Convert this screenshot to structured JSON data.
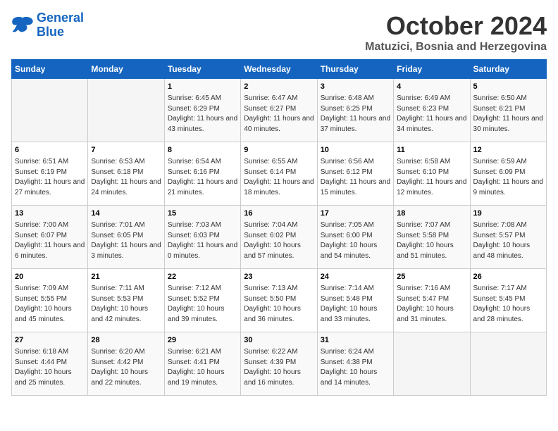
{
  "header": {
    "logo_line1": "General",
    "logo_line2": "Blue",
    "month": "October 2024",
    "location": "Matuzici, Bosnia and Herzegovina"
  },
  "weekdays": [
    "Sunday",
    "Monday",
    "Tuesday",
    "Wednesday",
    "Thursday",
    "Friday",
    "Saturday"
  ],
  "weeks": [
    [
      {
        "day": "",
        "sunrise": "",
        "sunset": "",
        "daylight": ""
      },
      {
        "day": "",
        "sunrise": "",
        "sunset": "",
        "daylight": ""
      },
      {
        "day": "1",
        "sunrise": "Sunrise: 6:45 AM",
        "sunset": "Sunset: 6:29 PM",
        "daylight": "Daylight: 11 hours and 43 minutes."
      },
      {
        "day": "2",
        "sunrise": "Sunrise: 6:47 AM",
        "sunset": "Sunset: 6:27 PM",
        "daylight": "Daylight: 11 hours and 40 minutes."
      },
      {
        "day": "3",
        "sunrise": "Sunrise: 6:48 AM",
        "sunset": "Sunset: 6:25 PM",
        "daylight": "Daylight: 11 hours and 37 minutes."
      },
      {
        "day": "4",
        "sunrise": "Sunrise: 6:49 AM",
        "sunset": "Sunset: 6:23 PM",
        "daylight": "Daylight: 11 hours and 34 minutes."
      },
      {
        "day": "5",
        "sunrise": "Sunrise: 6:50 AM",
        "sunset": "Sunset: 6:21 PM",
        "daylight": "Daylight: 11 hours and 30 minutes."
      }
    ],
    [
      {
        "day": "6",
        "sunrise": "Sunrise: 6:51 AM",
        "sunset": "Sunset: 6:19 PM",
        "daylight": "Daylight: 11 hours and 27 minutes."
      },
      {
        "day": "7",
        "sunrise": "Sunrise: 6:53 AM",
        "sunset": "Sunset: 6:18 PM",
        "daylight": "Daylight: 11 hours and 24 minutes."
      },
      {
        "day": "8",
        "sunrise": "Sunrise: 6:54 AM",
        "sunset": "Sunset: 6:16 PM",
        "daylight": "Daylight: 11 hours and 21 minutes."
      },
      {
        "day": "9",
        "sunrise": "Sunrise: 6:55 AM",
        "sunset": "Sunset: 6:14 PM",
        "daylight": "Daylight: 11 hours and 18 minutes."
      },
      {
        "day": "10",
        "sunrise": "Sunrise: 6:56 AM",
        "sunset": "Sunset: 6:12 PM",
        "daylight": "Daylight: 11 hours and 15 minutes."
      },
      {
        "day": "11",
        "sunrise": "Sunrise: 6:58 AM",
        "sunset": "Sunset: 6:10 PM",
        "daylight": "Daylight: 11 hours and 12 minutes."
      },
      {
        "day": "12",
        "sunrise": "Sunrise: 6:59 AM",
        "sunset": "Sunset: 6:09 PM",
        "daylight": "Daylight: 11 hours and 9 minutes."
      }
    ],
    [
      {
        "day": "13",
        "sunrise": "Sunrise: 7:00 AM",
        "sunset": "Sunset: 6:07 PM",
        "daylight": "Daylight: 11 hours and 6 minutes."
      },
      {
        "day": "14",
        "sunrise": "Sunrise: 7:01 AM",
        "sunset": "Sunset: 6:05 PM",
        "daylight": "Daylight: 11 hours and 3 minutes."
      },
      {
        "day": "15",
        "sunrise": "Sunrise: 7:03 AM",
        "sunset": "Sunset: 6:03 PM",
        "daylight": "Daylight: 11 hours and 0 minutes."
      },
      {
        "day": "16",
        "sunrise": "Sunrise: 7:04 AM",
        "sunset": "Sunset: 6:02 PM",
        "daylight": "Daylight: 10 hours and 57 minutes."
      },
      {
        "day": "17",
        "sunrise": "Sunrise: 7:05 AM",
        "sunset": "Sunset: 6:00 PM",
        "daylight": "Daylight: 10 hours and 54 minutes."
      },
      {
        "day": "18",
        "sunrise": "Sunrise: 7:07 AM",
        "sunset": "Sunset: 5:58 PM",
        "daylight": "Daylight: 10 hours and 51 minutes."
      },
      {
        "day": "19",
        "sunrise": "Sunrise: 7:08 AM",
        "sunset": "Sunset: 5:57 PM",
        "daylight": "Daylight: 10 hours and 48 minutes."
      }
    ],
    [
      {
        "day": "20",
        "sunrise": "Sunrise: 7:09 AM",
        "sunset": "Sunset: 5:55 PM",
        "daylight": "Daylight: 10 hours and 45 minutes."
      },
      {
        "day": "21",
        "sunrise": "Sunrise: 7:11 AM",
        "sunset": "Sunset: 5:53 PM",
        "daylight": "Daylight: 10 hours and 42 minutes."
      },
      {
        "day": "22",
        "sunrise": "Sunrise: 7:12 AM",
        "sunset": "Sunset: 5:52 PM",
        "daylight": "Daylight: 10 hours and 39 minutes."
      },
      {
        "day": "23",
        "sunrise": "Sunrise: 7:13 AM",
        "sunset": "Sunset: 5:50 PM",
        "daylight": "Daylight: 10 hours and 36 minutes."
      },
      {
        "day": "24",
        "sunrise": "Sunrise: 7:14 AM",
        "sunset": "Sunset: 5:48 PM",
        "daylight": "Daylight: 10 hours and 33 minutes."
      },
      {
        "day": "25",
        "sunrise": "Sunrise: 7:16 AM",
        "sunset": "Sunset: 5:47 PM",
        "daylight": "Daylight: 10 hours and 31 minutes."
      },
      {
        "day": "26",
        "sunrise": "Sunrise: 7:17 AM",
        "sunset": "Sunset: 5:45 PM",
        "daylight": "Daylight: 10 hours and 28 minutes."
      }
    ],
    [
      {
        "day": "27",
        "sunrise": "Sunrise: 6:18 AM",
        "sunset": "Sunset: 4:44 PM",
        "daylight": "Daylight: 10 hours and 25 minutes."
      },
      {
        "day": "28",
        "sunrise": "Sunrise: 6:20 AM",
        "sunset": "Sunset: 4:42 PM",
        "daylight": "Daylight: 10 hours and 22 minutes."
      },
      {
        "day": "29",
        "sunrise": "Sunrise: 6:21 AM",
        "sunset": "Sunset: 4:41 PM",
        "daylight": "Daylight: 10 hours and 19 minutes."
      },
      {
        "day": "30",
        "sunrise": "Sunrise: 6:22 AM",
        "sunset": "Sunset: 4:39 PM",
        "daylight": "Daylight: 10 hours and 16 minutes."
      },
      {
        "day": "31",
        "sunrise": "Sunrise: 6:24 AM",
        "sunset": "Sunset: 4:38 PM",
        "daylight": "Daylight: 10 hours and 14 minutes."
      },
      {
        "day": "",
        "sunrise": "",
        "sunset": "",
        "daylight": ""
      },
      {
        "day": "",
        "sunrise": "",
        "sunset": "",
        "daylight": ""
      }
    ]
  ]
}
